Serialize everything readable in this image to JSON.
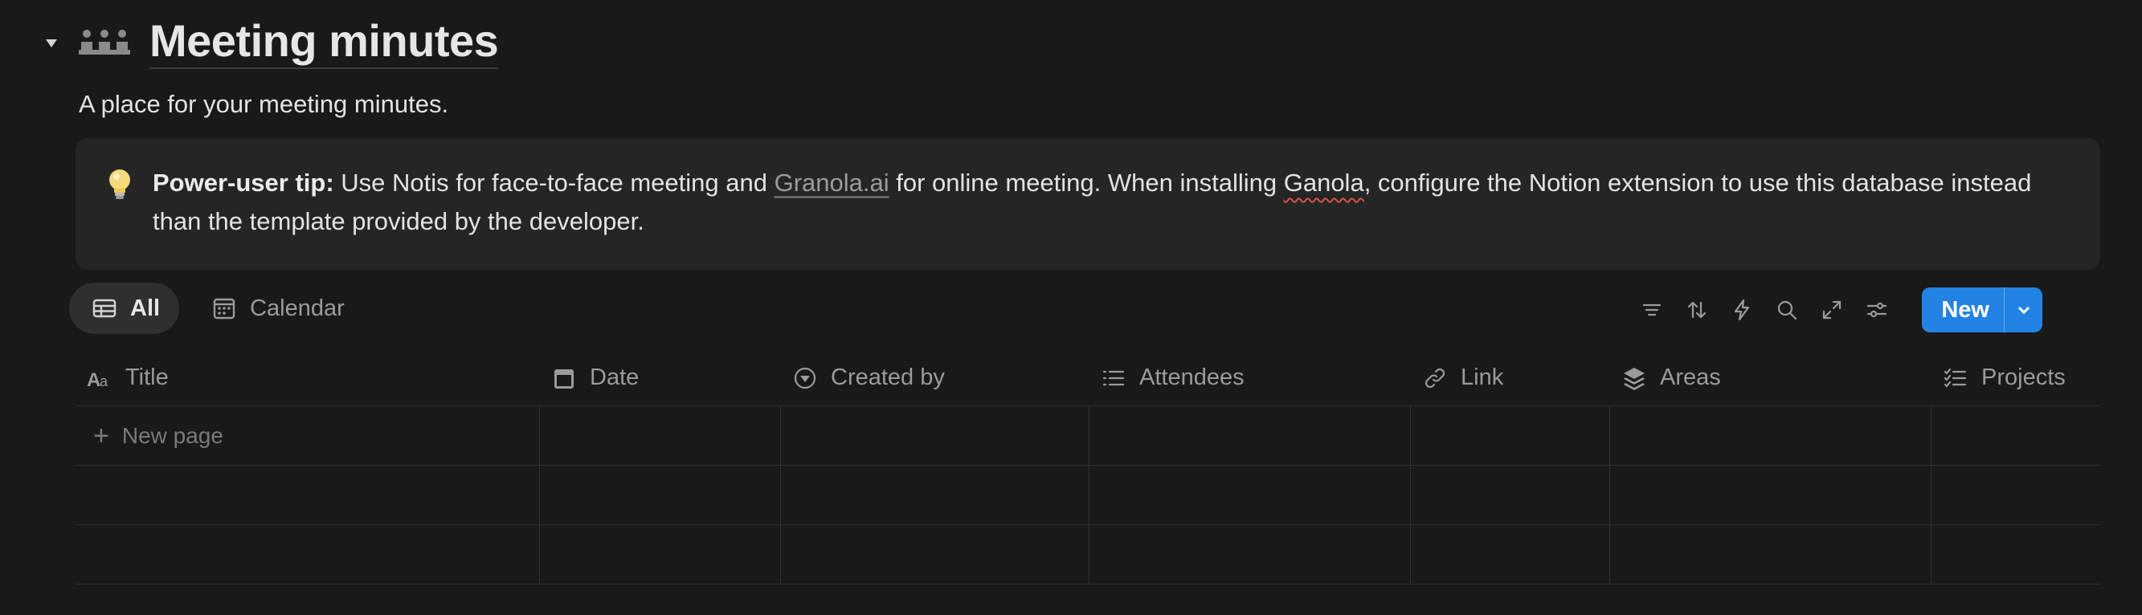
{
  "header": {
    "title": "Meeting minutes",
    "description": "A place for your meeting minutes."
  },
  "callout": {
    "icon": "lightbulb-icon",
    "strong": "Power-user tip:",
    "part1": " Use Notis for face-to-face meeting and ",
    "link": "Granola.ai",
    "part2": " for online meeting. When installing ",
    "misspelled": "Ganola",
    "part3": ", configure the Notion extension to use this database instead than the template provided by the developer."
  },
  "views": [
    {
      "label": "All",
      "icon": "table-icon",
      "active": true
    },
    {
      "label": "Calendar",
      "icon": "calendar-icon",
      "active": false
    }
  ],
  "toolbar": {
    "new_label": "New",
    "icons": [
      "filter-icon",
      "sort-icon",
      "automation-icon",
      "search-icon",
      "expand-icon",
      "settings-icon"
    ]
  },
  "table": {
    "columns": [
      {
        "label": "Title",
        "icon": "text-icon"
      },
      {
        "label": "Date",
        "icon": "calendar-icon"
      },
      {
        "label": "Created by",
        "icon": "person-icon"
      },
      {
        "label": "Attendees",
        "icon": "list-icon"
      },
      {
        "label": "Link",
        "icon": "link-icon"
      },
      {
        "label": "Areas",
        "icon": "layers-icon"
      },
      {
        "label": "Projects",
        "icon": "checklist-icon"
      }
    ],
    "new_page_label": "New page"
  },
  "colors": {
    "background": "#191919",
    "callout_bg": "#252525",
    "accent": "#2383e2"
  }
}
